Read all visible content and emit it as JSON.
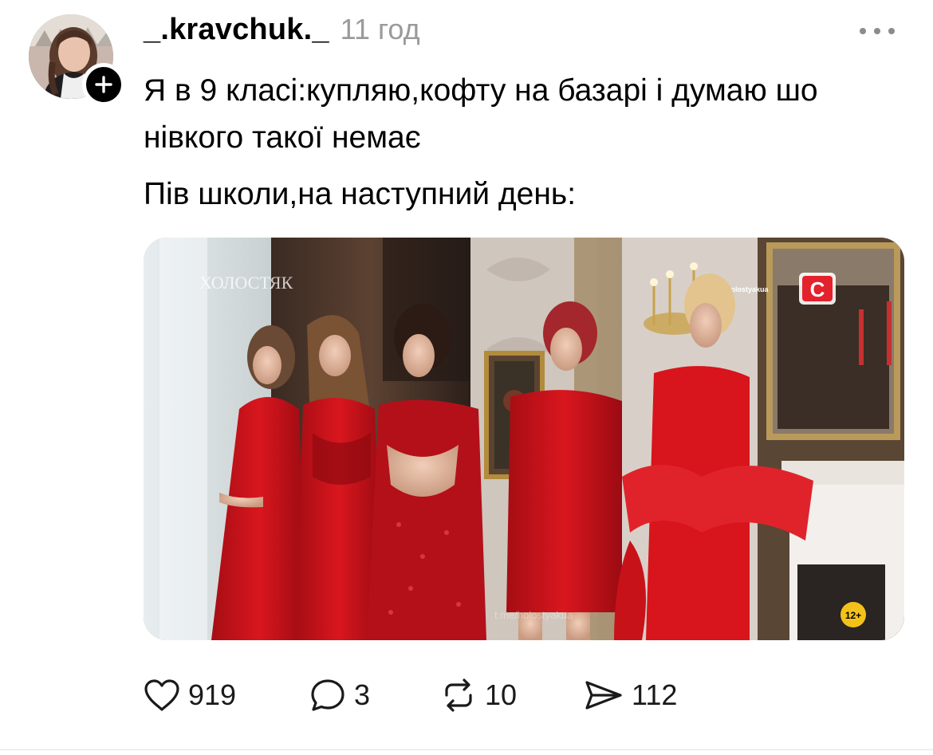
{
  "post": {
    "username": "_.kravchuk._",
    "timestamp": "11 год",
    "text_lines": [
      "Я в 9 класі:купляю,кофту на базарі і думаю шо нівкого такої немає",
      "Пів школи,на наступний день:"
    ],
    "media": {
      "overlay_logo": "ХОЛОСТЯК",
      "overlay_url": "t.me/holostyakua",
      "channel_badge": "C",
      "age_rating": "12+",
      "watermark": "t.me/holostyakua"
    },
    "actions": {
      "likes": "919",
      "replies": "3",
      "reposts": "10",
      "shares": "112"
    }
  },
  "icons": {
    "follow": "plus-icon",
    "more": "ellipsis-icon",
    "like": "heart-icon",
    "reply": "speech-bubble-icon",
    "repost": "repost-arrows-icon",
    "share": "paper-plane-icon"
  },
  "colors": {
    "text": "#000000",
    "muted": "#9a9a9a",
    "dress_red": "#d4141c"
  }
}
